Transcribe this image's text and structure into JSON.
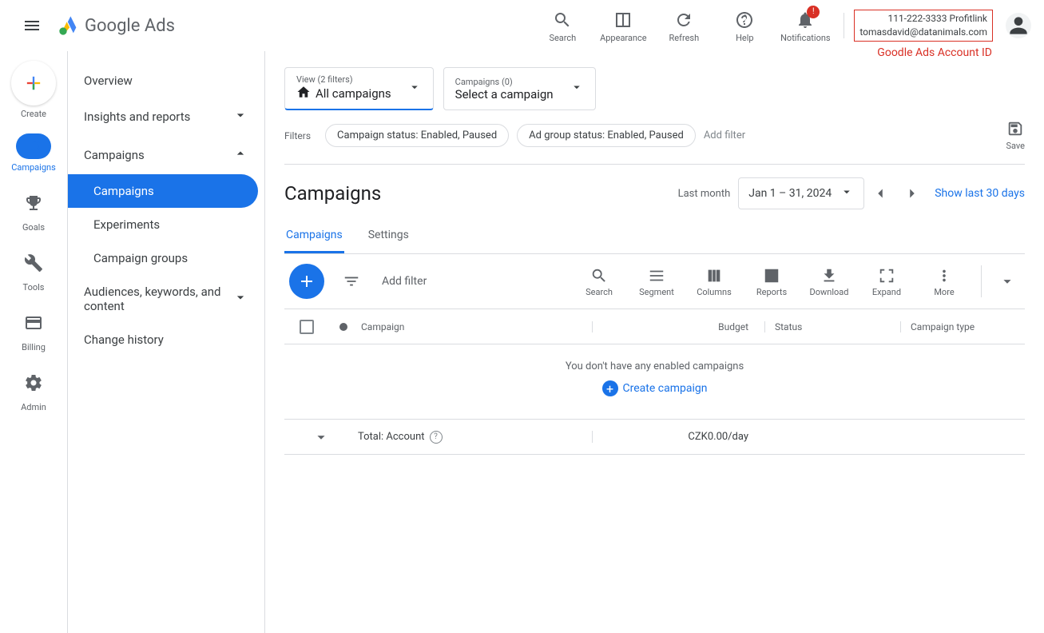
{
  "header": {
    "product": "Google Ads",
    "actions": {
      "search": "Search",
      "appearance": "Appearance",
      "refresh": "Refresh",
      "help": "Help",
      "notifications": "Notifications"
    },
    "notif_badge": "!",
    "account_line1": "111-222-3333 Profitlink",
    "account_line2": "tomasdavid@datanimals.com",
    "account_annotation": "Goodle Ads Account ID"
  },
  "rail": {
    "create": "Create",
    "campaigns": "Campaigns",
    "goals": "Goals",
    "tools": "Tools",
    "billing": "Billing",
    "admin": "Admin"
  },
  "sidebar": {
    "overview": "Overview",
    "insights": "Insights and reports",
    "campaigns": "Campaigns",
    "sub_campaigns": "Campaigns",
    "sub_experiments": "Experiments",
    "sub_groups": "Campaign groups",
    "audiences": "Audiences, keywords, and content",
    "history": "Change history"
  },
  "view_dropdown": {
    "top": "View (2 filters)",
    "main": "All campaigns"
  },
  "campaign_dropdown": {
    "top": "Campaigns (0)",
    "main": "Select a campaign"
  },
  "filters": {
    "label": "Filters",
    "chip1": "Campaign status: Enabled, Paused",
    "chip2": "Ad group status: Enabled, Paused",
    "add": "Add filter",
    "save": "Save"
  },
  "page": {
    "title": "Campaigns",
    "date_prefix": "Last month",
    "date_range": "Jan 1 – 31, 2024",
    "show_days": "Show last 30 days"
  },
  "tabs": {
    "campaigns": "Campaigns",
    "settings": "Settings"
  },
  "toolbar": {
    "add_filter": "Add filter",
    "search": "Search",
    "segment": "Segment",
    "columns": "Columns",
    "reports": "Reports",
    "download": "Download",
    "expand": "Expand",
    "more": "More"
  },
  "table": {
    "col_campaign": "Campaign",
    "col_budget": "Budget",
    "col_status": "Status",
    "col_type": "Campaign type",
    "empty": "You don't have any enabled campaigns",
    "create": "Create campaign",
    "total_label": "Total: Account",
    "total_budget": "CZK0.00/day"
  }
}
